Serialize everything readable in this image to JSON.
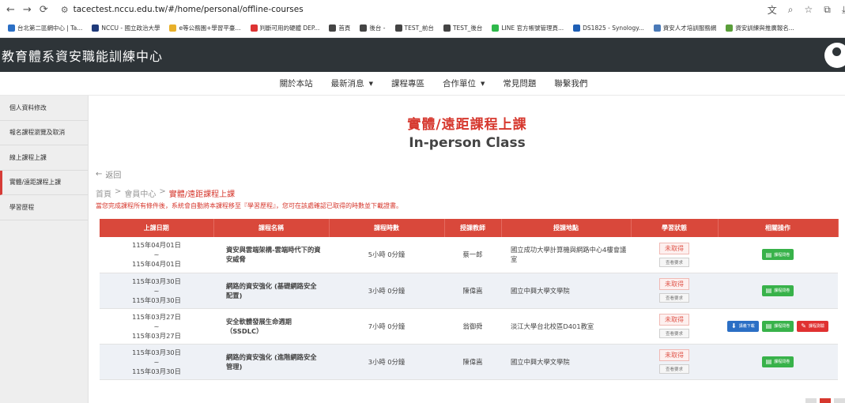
{
  "browser": {
    "back": "←",
    "forward": "→",
    "reload": "⟳",
    "url": "tacectest.nccu.edu.tw/#/home/personal/offline-courses",
    "bookmarks": [
      {
        "label": "台北第二區網中心 | Ta...",
        "color": "#2b6fc5"
      },
      {
        "label": "NCCU - 國立政治大學",
        "color": "#1f3a7a"
      },
      {
        "label": "e等公務園+學習平臺...",
        "color": "#e8b02a"
      },
      {
        "label": "判斷可用的硬體 DEP...",
        "color": "#d33"
      },
      {
        "label": "首頁",
        "color": "#444"
      },
      {
        "label": "後台 -",
        "color": "#444"
      },
      {
        "label": "TEST_前台",
        "color": "#444"
      },
      {
        "label": "TEST_後台",
        "color": "#444"
      },
      {
        "label": "LINE 官方帳號管理頁...",
        "color": "#2fb94b"
      },
      {
        "label": "DS1825 - Synology...",
        "color": "#1f5fb5"
      },
      {
        "label": "資安人才培訓服務網",
        "color": "#4a7ab8"
      },
      {
        "label": "資安訓練與推廣報名...",
        "color": "#5a9e3a"
      }
    ]
  },
  "header": {
    "site_title": "教育體系資安職能訓練中心"
  },
  "nav": {
    "items": [
      {
        "label": "關於本站",
        "dropdown": false
      },
      {
        "label": "最新消息",
        "dropdown": true
      },
      {
        "label": "課程專區",
        "dropdown": false
      },
      {
        "label": "合作單位",
        "dropdown": true
      },
      {
        "label": "常見問題",
        "dropdown": false
      },
      {
        "label": "聯繫我們",
        "dropdown": false
      }
    ]
  },
  "sidebar": {
    "items": [
      {
        "label": "個人資料修改",
        "active": false
      },
      {
        "label": "報名課程瀏覽及取消",
        "active": false
      },
      {
        "label": "線上課程上課",
        "active": false
      },
      {
        "label": "實體/遠距課程上課",
        "active": true
      },
      {
        "label": "學習歷程",
        "active": false
      }
    ]
  },
  "page": {
    "title_zh": "實體/遠距課程上課",
    "title_en": "In-person Class",
    "back": "返回",
    "breadcrumb": [
      "首頁",
      "會員中心",
      "實體/遠距課程上課"
    ],
    "notice": "當您完成課程所有條件後，系統會自動將本課程移至『學習歷程』，您可在該處確認已取得的時數並下載證書。"
  },
  "table": {
    "headers": [
      "上課日期",
      "課程名稱",
      "課程時數",
      "授課教師",
      "授課地點",
      "學習狀態",
      "相關操作"
    ],
    "rows": [
      {
        "date_start": "115年04月01日",
        "sep": "~",
        "date_end": "115年04月01日",
        "name": "資安與雲端架構-雲端時代下的資安威脅",
        "hours": "5小時 0分鐘",
        "teacher": "蔡一郎",
        "place": "國立成功大學計算機與網路中心4樓會議室",
        "status": "未取得",
        "status_sub": "查看要求",
        "ops": [
          {
            "label": "課程問卷",
            "kind": "green",
            "icon": "▤"
          }
        ]
      },
      {
        "date_start": "115年03月30日",
        "sep": "~",
        "date_end": "115年03月30日",
        "name": "網路的資安強化 (基礎網路安全配置)",
        "hours": "3小時 0分鐘",
        "teacher": "陳偉嵩",
        "place": "國立中興大學文學院",
        "status": "未取得",
        "status_sub": "查看要求",
        "ops": [
          {
            "label": "課程問卷",
            "kind": "green",
            "icon": "▤"
          }
        ]
      },
      {
        "date_start": "115年03月27日",
        "sep": "~",
        "date_end": "115年03月27日",
        "name": "安全軟體發展生命週期（SSDLC）",
        "hours": "7小時 0分鐘",
        "teacher": "翁御舜",
        "place": "淡江大學台北校區D401教室",
        "status": "未取得",
        "status_sub": "查看要求",
        "ops": [
          {
            "label": "講義下載",
            "kind": "blue",
            "icon": "⬇"
          },
          {
            "label": "課程問卷",
            "kind": "green",
            "icon": "▤"
          },
          {
            "label": "課程測驗",
            "kind": "red",
            "icon": "✎"
          }
        ]
      },
      {
        "date_start": "115年03月30日",
        "sep": "~",
        "date_end": "115年03月30日",
        "name": "網路的資安強化 (進階網路安全管理)",
        "hours": "3小時 0分鐘",
        "teacher": "陳偉嵩",
        "place": "國立中興大學文學院",
        "status": "未取得",
        "status_sub": "查看要求",
        "ops": [
          {
            "label": "課程問卷",
            "kind": "green",
            "icon": "▤"
          }
        ]
      }
    ]
  }
}
